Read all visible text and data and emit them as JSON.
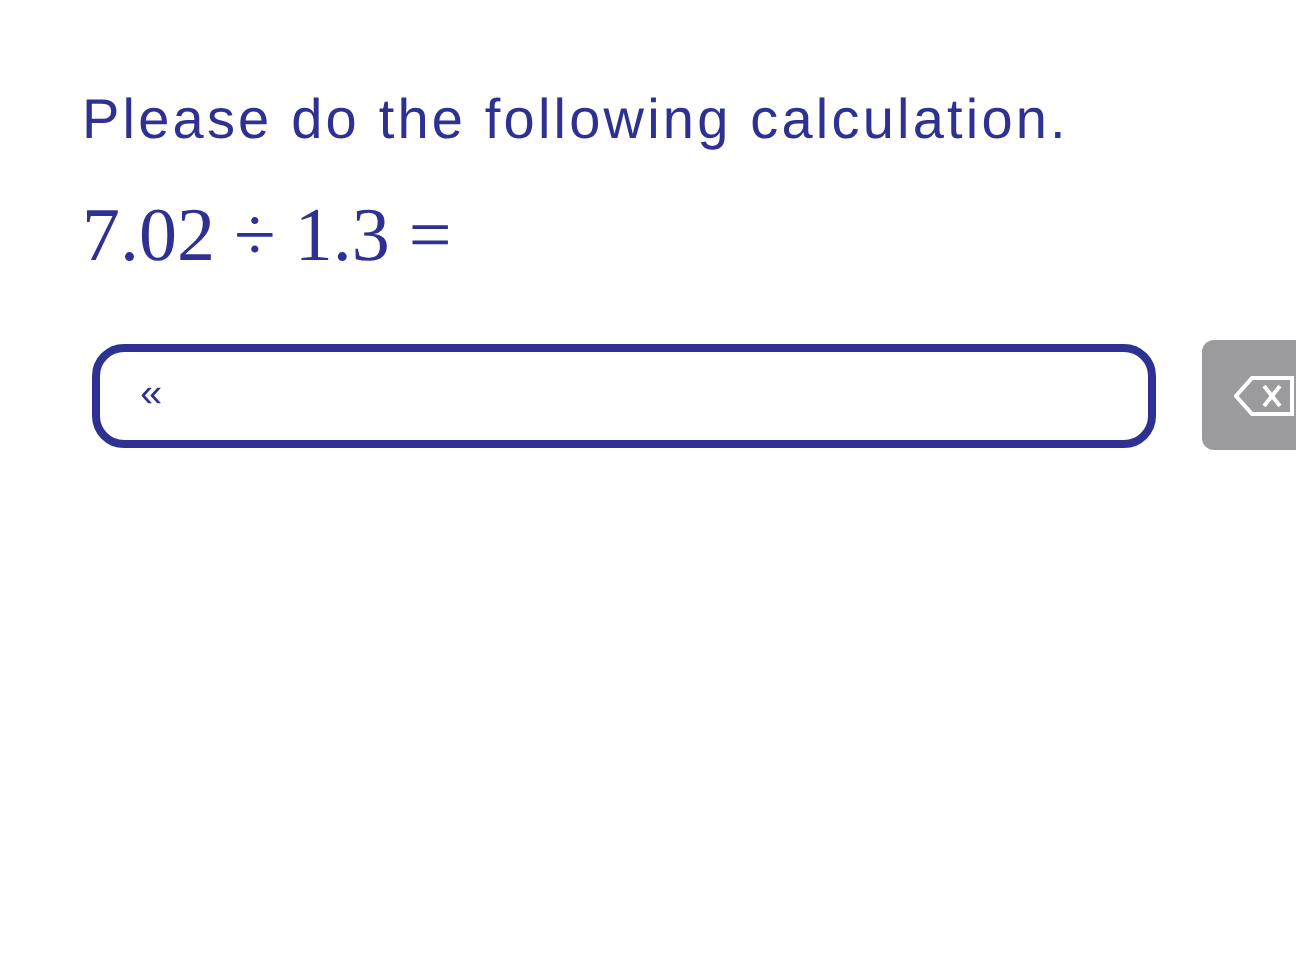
{
  "prompt": "Please do the following calculation.",
  "equation": "7.02 ÷ 1.3 =",
  "answer_field": {
    "value": "«"
  },
  "backspace_button": {
    "kind": "backspace"
  }
}
